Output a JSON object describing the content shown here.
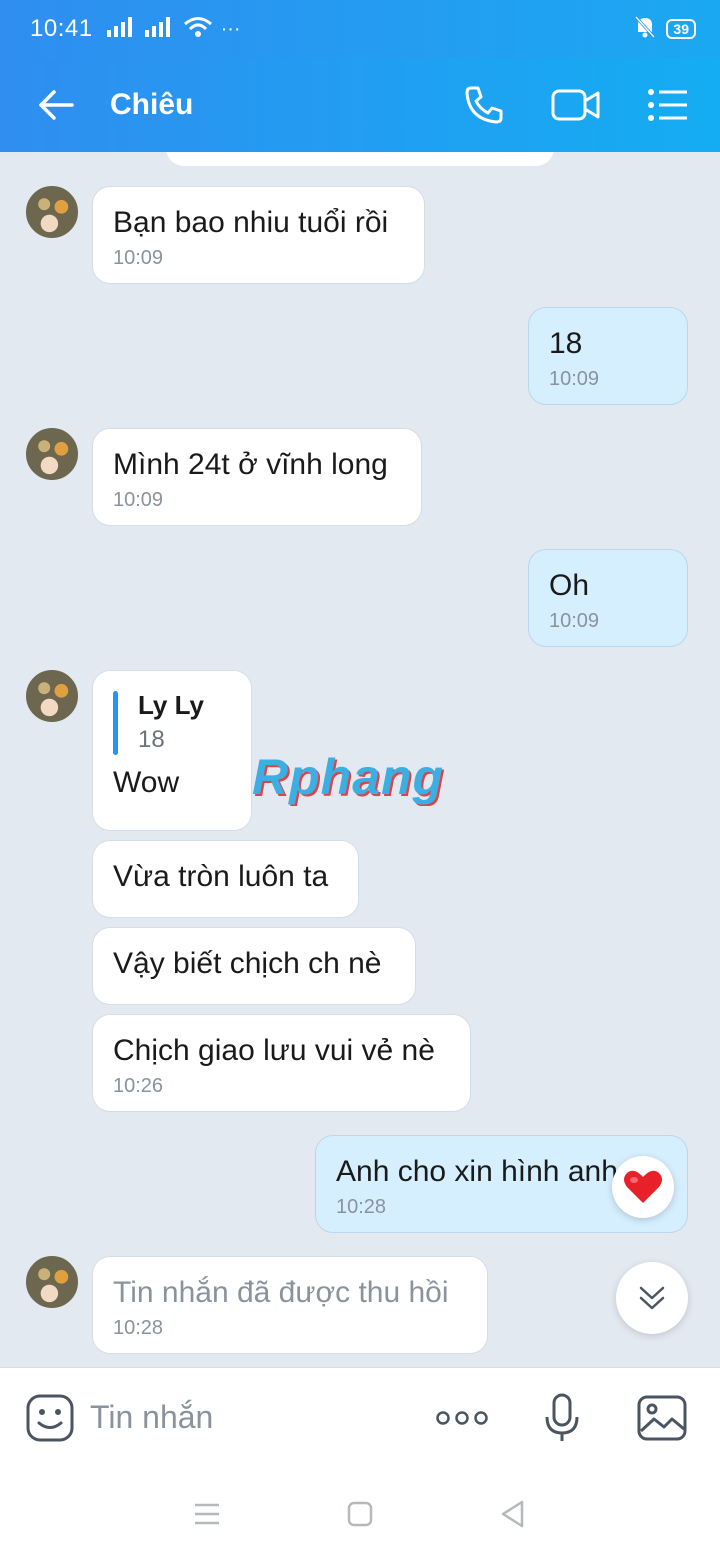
{
  "status_bar": {
    "time": "10:41",
    "ellipsis": "···",
    "battery": "39"
  },
  "header": {
    "contact_name": "Chiêu"
  },
  "messages": [
    {
      "text": "Bạn bao nhiu tuổi rồi",
      "time": "10:09"
    },
    {
      "text": "18",
      "time": "10:09"
    },
    {
      "text": "Mình 24t ở vĩnh long",
      "time": "10:09"
    },
    {
      "text": "Oh",
      "time": "10:09"
    },
    {
      "quote_name": "Ly Ly",
      "quote_text": "18",
      "text": "Wow"
    },
    {
      "text": "Vừa tròn luôn ta"
    },
    {
      "text": "Vậy biết chịch ch nè"
    },
    {
      "text": "Chịch giao lưu vui vẻ nè",
      "time": "10:26"
    },
    {
      "text": "Anh cho xin hình anh đi",
      "time": "10:28"
    },
    {
      "text": "Tin nhắn đã được thu hồi",
      "time": "10:28"
    }
  ],
  "watermark": "Rphang",
  "input": {
    "placeholder": "Tin nhắn"
  },
  "colors": {
    "header": "#2f8ef0",
    "incoming": "#ffffff",
    "outgoing": "#d6efff",
    "background": "#e3e9f1"
  }
}
